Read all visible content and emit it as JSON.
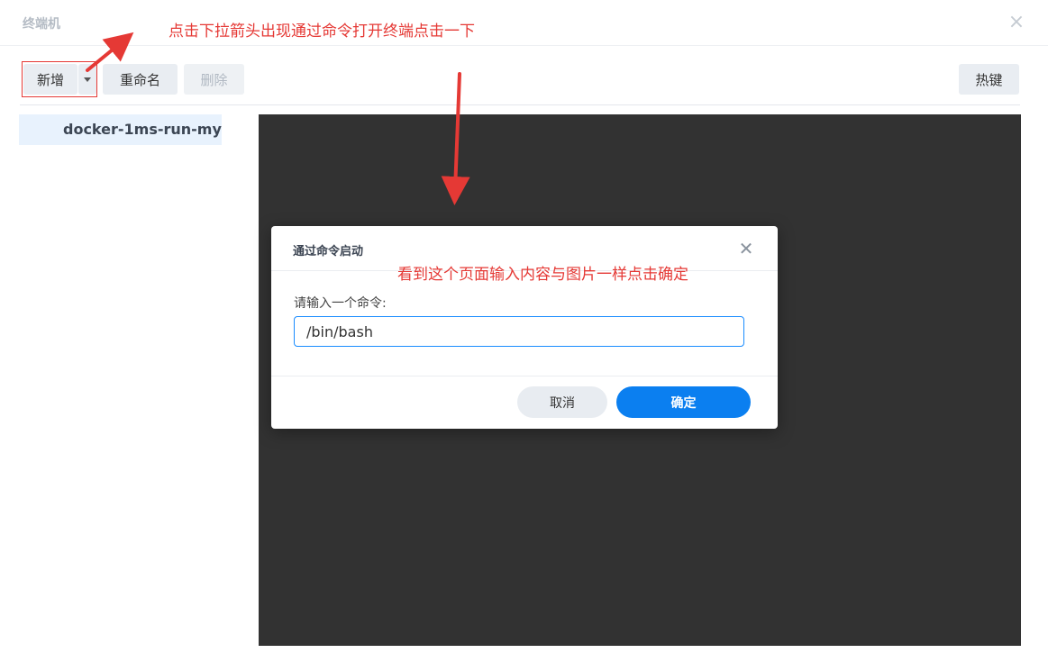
{
  "window": {
    "title": "终端机",
    "close_glyph": "×"
  },
  "toolbar": {
    "new_label": "新增",
    "rename_label": "重命名",
    "delete_label": "删除",
    "hotkey_label": "热键"
  },
  "sessions": [
    {
      "name": "docker-1ms-run-my"
    }
  ],
  "dialog": {
    "title": "通过命令启动",
    "close_glyph": "✕",
    "prompt_label": "请输入一个命令:",
    "command_value": "/bin/bash",
    "cancel_label": "取消",
    "ok_label": "确定"
  },
  "annotations": {
    "top": "点击下拉箭头出现通过命令打开终端点击一下",
    "dialog": "看到这个页面输入内容与图片一样点击确定",
    "color": "#e53935"
  },
  "colors": {
    "accent": "#0b7ff0",
    "terminal_bg": "#323232",
    "selected_item_bg": "#e8f2fd"
  }
}
